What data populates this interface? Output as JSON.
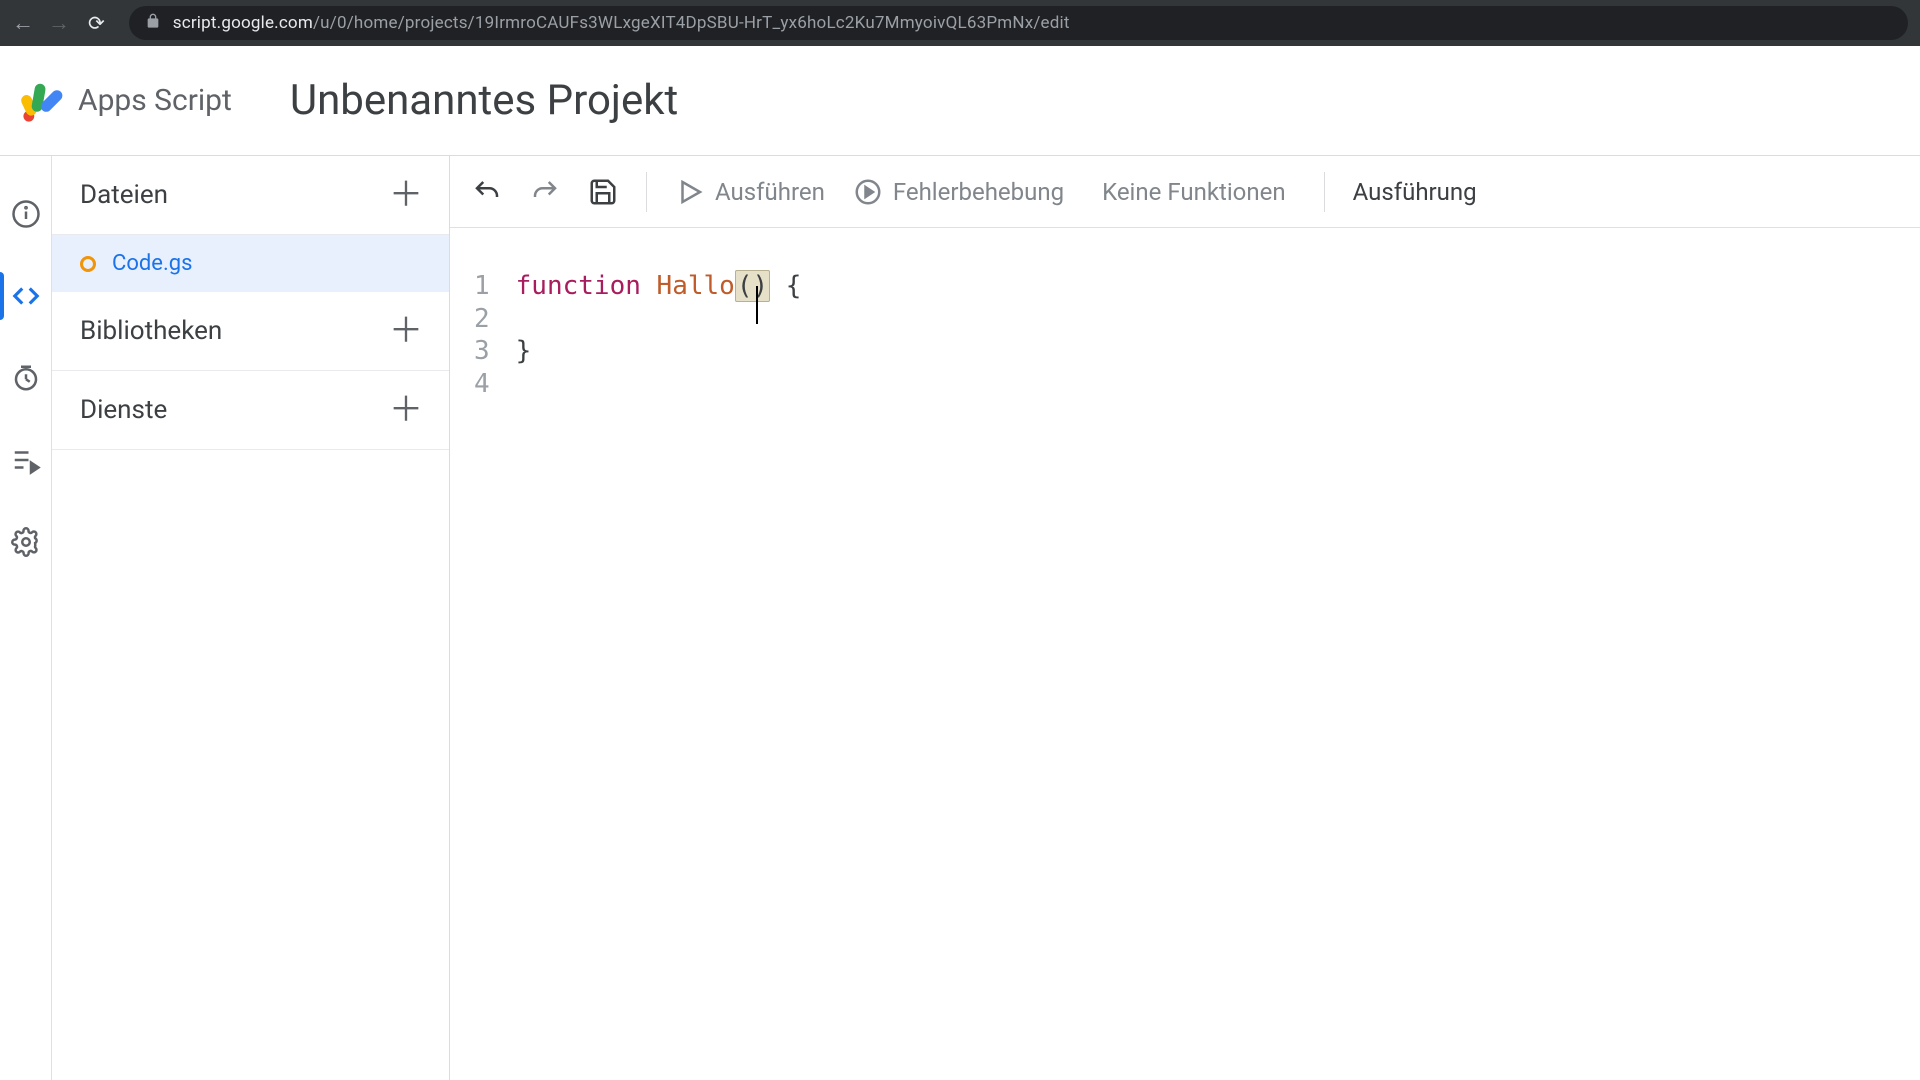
{
  "browser": {
    "url_prefix": "script.google.com",
    "url_path": "/u/0/home/projects/19IrmroCAUFs3WLxgeXIT4DpSBU-HrT_yx6hoLc2Ku7MmyoivQL63PmNx/edit"
  },
  "header": {
    "app_name": "Apps Script",
    "project_title": "Unbenanntes Projekt"
  },
  "sidebar": {
    "sections": {
      "files": "Dateien",
      "libraries": "Bibliotheken",
      "services": "Dienste"
    },
    "files": [
      {
        "name": "Code.gs",
        "dirty": true,
        "active": true
      }
    ]
  },
  "toolbar": {
    "run": "Ausführen",
    "debug": "Fehlerbehebung",
    "fn_select": "Keine Funktionen",
    "exec_log": "Ausführung"
  },
  "editor": {
    "line_numbers": [
      "1",
      "2",
      "3",
      "4"
    ],
    "tokens": {
      "keyword": "function",
      "fn_name": "Hallo",
      "parens": "()",
      "brace_open": "{",
      "brace_close": "}"
    }
  }
}
